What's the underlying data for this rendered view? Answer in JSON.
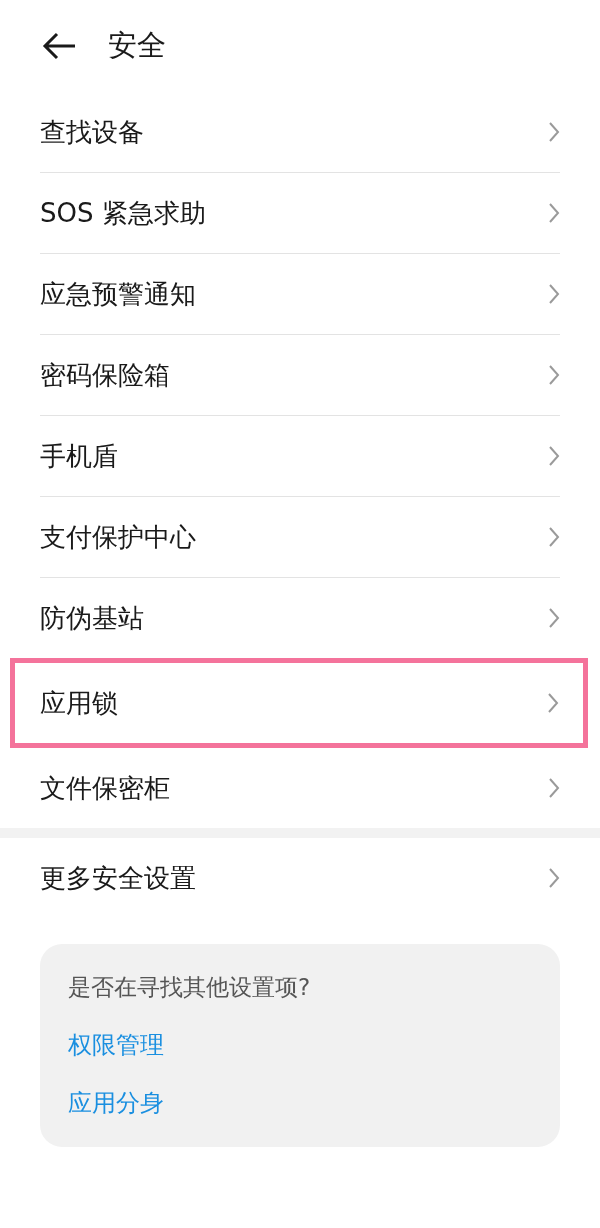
{
  "header": {
    "title": "安全"
  },
  "groups": [
    {
      "items": [
        {
          "label": "查找设备",
          "highlighted": false
        },
        {
          "label": "SOS 紧急求助",
          "highlighted": false
        },
        {
          "label": "应急预警通知",
          "highlighted": false
        },
        {
          "label": "密码保险箱",
          "highlighted": false
        },
        {
          "label": "手机盾",
          "highlighted": false
        },
        {
          "label": "支付保护中心",
          "highlighted": false
        },
        {
          "label": "防伪基站",
          "highlighted": false
        },
        {
          "label": "应用锁",
          "highlighted": true
        },
        {
          "label": "文件保密柜",
          "highlighted": false
        }
      ]
    },
    {
      "items": [
        {
          "label": "更多安全设置",
          "highlighted": false
        }
      ]
    }
  ],
  "suggestion_card": {
    "question": "是否在寻找其他设置项?",
    "links": [
      "权限管理",
      "应用分身"
    ]
  }
}
